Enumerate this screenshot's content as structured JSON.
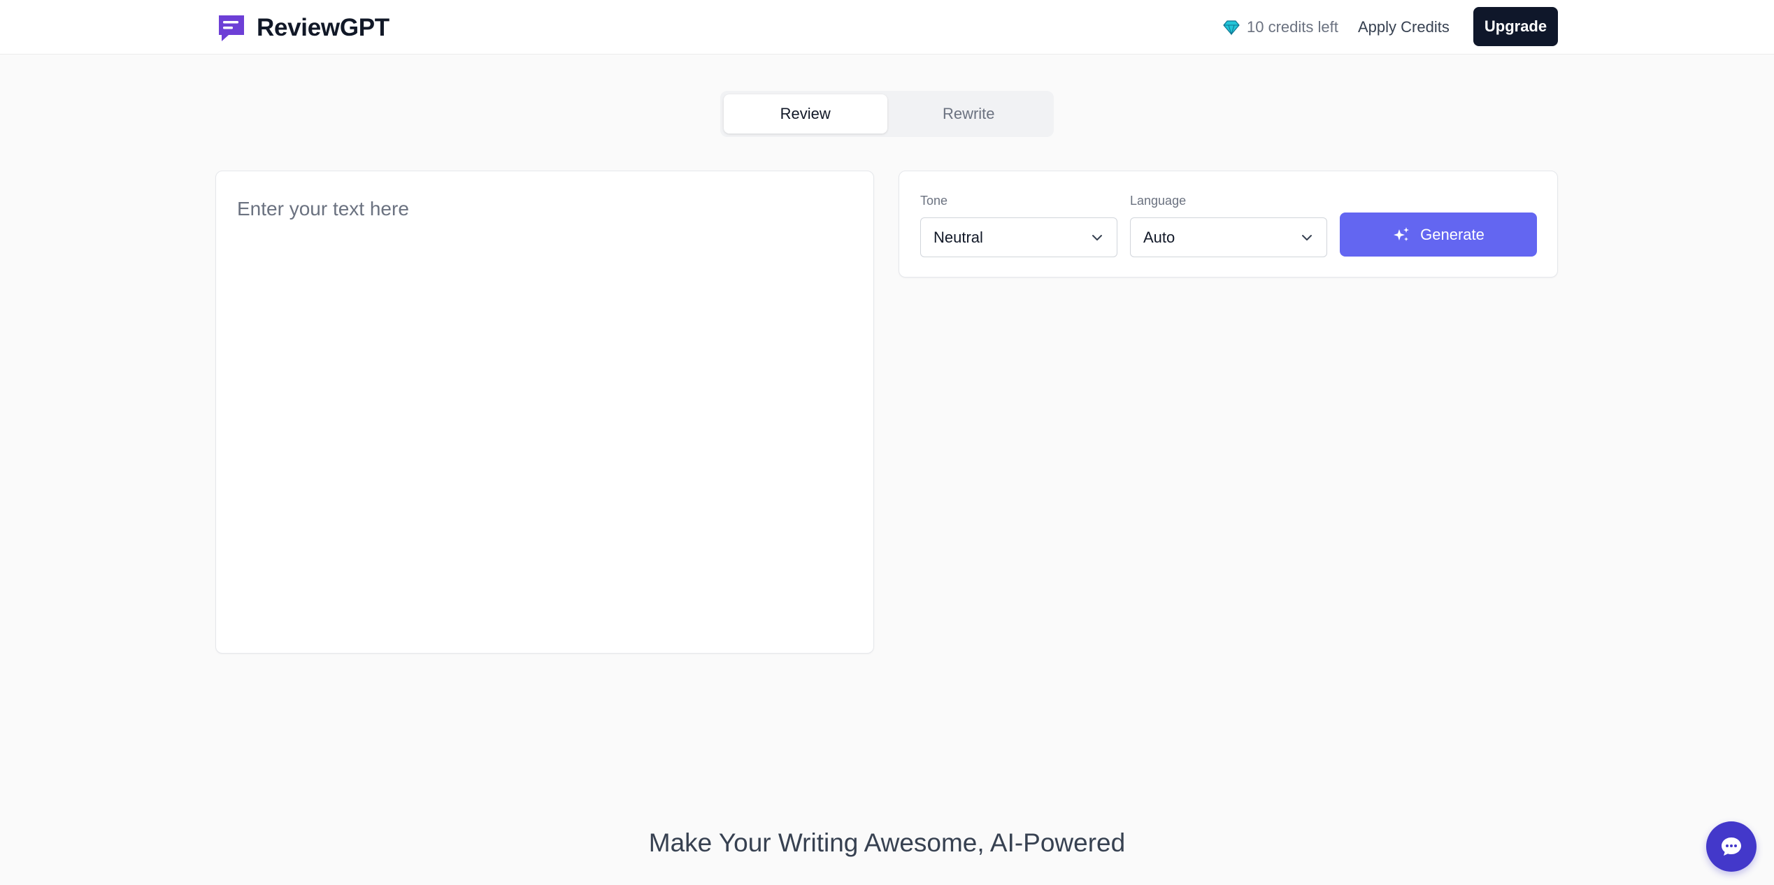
{
  "header": {
    "app_name": "ReviewGPT",
    "credits_text": "10 credits left",
    "apply_credits_label": "Apply Credits",
    "upgrade_label": "Upgrade"
  },
  "tabs": [
    {
      "label": "Review",
      "active": true
    },
    {
      "label": "Rewrite",
      "active": false
    }
  ],
  "editor": {
    "placeholder": "Enter your text here",
    "value": ""
  },
  "settings": {
    "tone": {
      "label": "Tone",
      "value": "Neutral"
    },
    "language": {
      "label": "Language",
      "value": "Auto"
    },
    "generate_label": "Generate"
  },
  "hero": {
    "title": "Make Your Writing Awesome, AI-Powered"
  },
  "icons": {
    "logo": "message-square-icon",
    "credits": "gem-icon",
    "generate": "sparkles-icon",
    "select": "chevron-down-icon",
    "chat": "chat-bubble-icon"
  },
  "colors": {
    "brand": "#6d3fd6",
    "accent": "#6366f1",
    "upgrade_bg": "#0f172a",
    "chat_bg": "#4338ca",
    "gem": "#22c5d8"
  }
}
